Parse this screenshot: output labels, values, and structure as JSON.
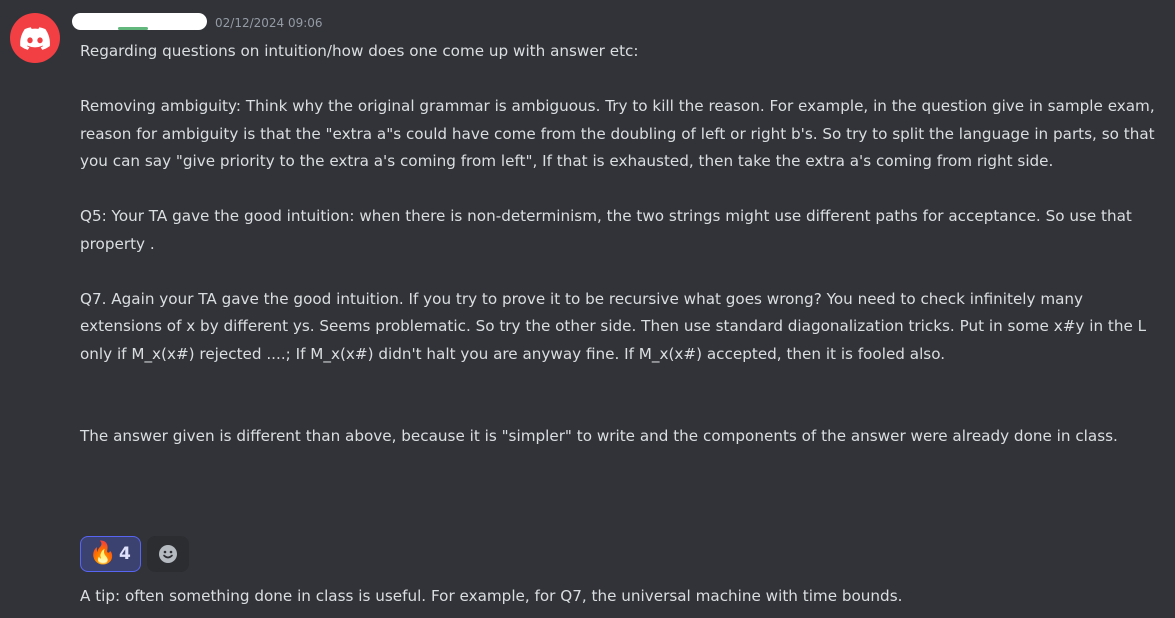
{
  "message": {
    "timestamp": "02/12/2024 09:06",
    "avatar_icon": "discord-logo",
    "accent_color": "#f23f43",
    "paragraphs": [
      "Regarding questions on intuition/how does one come up with answer etc:",
      "Removing ambiguity: Think why the original grammar is ambiguous. Try to kill the reason. For example, in the question give in sample exam, reason for ambiguity is that the \"extra a\"s could have come from the doubling of left or right b's.  So try to split the language in parts, so that you can say \"give priority to the extra a's coming from left\", If that is exhausted, then take the extra a's coming from right side.",
      "Q5: Your TA gave the good intuition: when there is non-determinism, the two strings might use different paths for acceptance. So use that property .",
      "Q7. Again your TA gave the good intuition. If you try to prove it to be recursive what goes wrong? You need to check infinitely many extensions of x by different ys. Seems problematic. So try the other side. Then use standard diagonalization tricks. Put in some x#y in the L only if M_x(x#) rejected ....; If M_x(x#) didn't halt you are anyway fine. If M_x(x#) accepted, then it is fooled also.",
      "The answer given is different than above, because it is \"simpler\" to write and the components of the answer were already done in class."
    ],
    "reactions": [
      {
        "emoji": "🔥",
        "icon": "fire-emoji",
        "count": "4"
      }
    ],
    "add_reaction_icon": "smiley-add-reaction-icon"
  },
  "followup": {
    "text": "A tip: often something done in class is useful. For example, for Q7, the universal machine with time bounds."
  }
}
